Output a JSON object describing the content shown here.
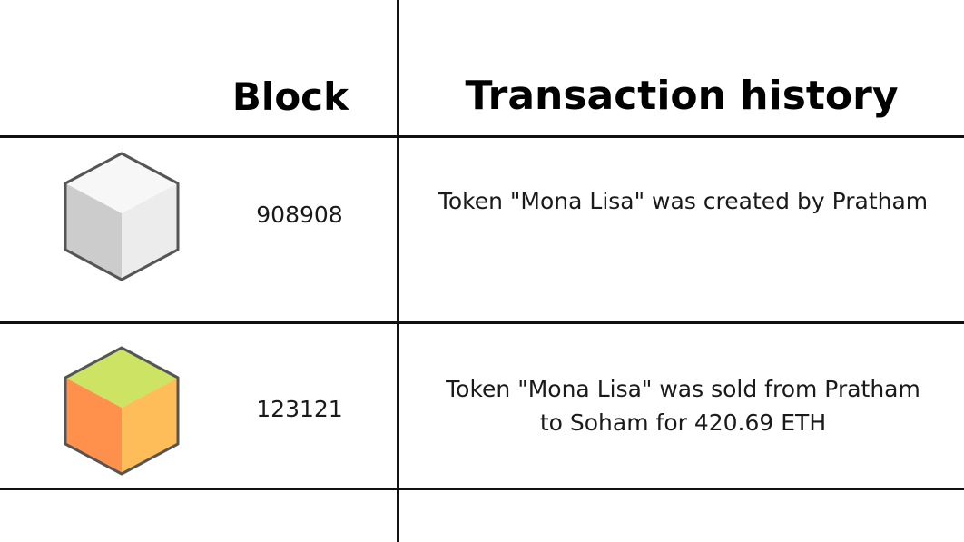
{
  "headers": {
    "block": "Block",
    "transaction_history": "Transaction history"
  },
  "rows": [
    {
      "block_number": "908908",
      "transaction": "Token \"Mona Lisa\" was created by Pratham",
      "cube_icon": "grey-cube-icon",
      "cube_colors": {
        "top": "#f7f7f7",
        "left": "#cccccc",
        "right": "#ececec",
        "stroke": "#555555"
      }
    },
    {
      "block_number": "123121",
      "transaction": "Token \"Mona Lisa\" was sold from Pratham to Soham for 420.69 ETH",
      "cube_icon": "colored-cube-icon",
      "cube_colors": {
        "top": "#cde364",
        "left": "#ff914d",
        "right": "#ffbd59",
        "stroke": "#555555"
      }
    }
  ],
  "colors": {
    "background": "#ffffff",
    "grid_lines": "#111111",
    "text": "#111111"
  }
}
